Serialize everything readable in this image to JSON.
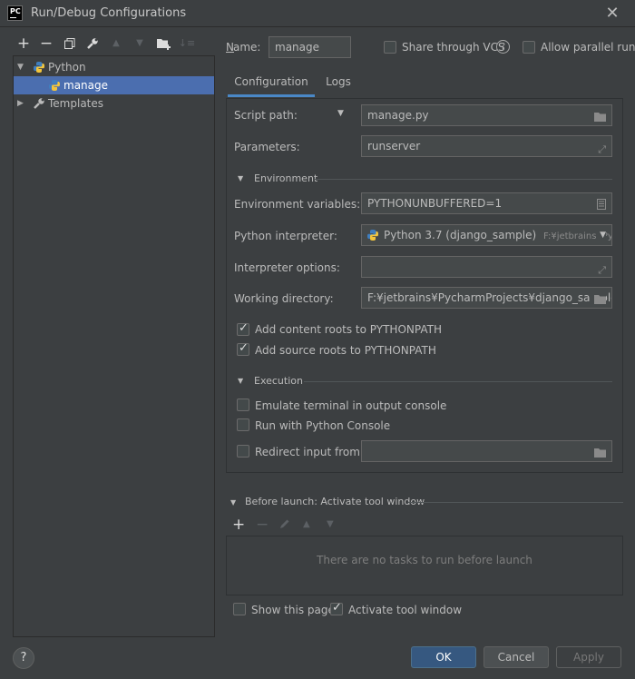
{
  "window": {
    "title": "Run/Debug Configurations",
    "app_icon": "PC"
  },
  "toolbar": {
    "icons": [
      "add-icon",
      "remove-icon",
      "copy-icon",
      "wrench-icon",
      "move-up-icon",
      "move-down-icon",
      "new-folder-icon",
      "sort-icon"
    ]
  },
  "tree": {
    "python_label": "Python",
    "manage_label": "manage",
    "templates_label": "Templates"
  },
  "header": {
    "name_label": "Name:",
    "name_value": "manage",
    "share_vcs_label": "Share through VCS",
    "allow_parallel_label": "Allow parallel run"
  },
  "tabs": [
    {
      "label": "Configuration"
    },
    {
      "label": "Logs"
    }
  ],
  "config": {
    "script_path_label": "Script path:",
    "script_path_value": "manage.py",
    "parameters_label": "Parameters:",
    "parameters_value": "runserver",
    "environment_section": "Environment",
    "env_vars_label": "Environment variables:",
    "env_vars_value": "PYTHONUNBUFFERED=1",
    "interpreter_label": "Python interpreter:",
    "interpreter_value": "Python 3.7 (django_sample)",
    "interpreter_path": "F:¥jetbrains¥Pych",
    "interpreter_options_label": "Interpreter options:",
    "interpreter_options_value": "",
    "working_dir_label": "Working directory:",
    "working_dir_value": "F:¥jetbrains¥PycharmProjects¥django_sample",
    "add_content_roots_label": "Add content roots to PYTHONPATH",
    "add_source_roots_label": "Add source roots to PYTHONPATH",
    "execution_section": "Execution",
    "emulate_terminal_label": "Emulate terminal in output console",
    "run_python_console_label": "Run with Python Console",
    "redirect_input_label": "Redirect input from:",
    "redirect_input_value": ""
  },
  "before_launch": {
    "title": "Before launch: Activate tool window",
    "empty_text": "There are no tasks to run before launch",
    "show_page_label": "Show this page",
    "activate_tool_label": "Activate tool window"
  },
  "buttons": {
    "ok": "OK",
    "cancel": "Cancel",
    "apply": "Apply",
    "help": "?"
  },
  "colors": {
    "selection": "#4b6eaf",
    "ok_button": "#365880",
    "tab_underline": "#4a88c7"
  }
}
